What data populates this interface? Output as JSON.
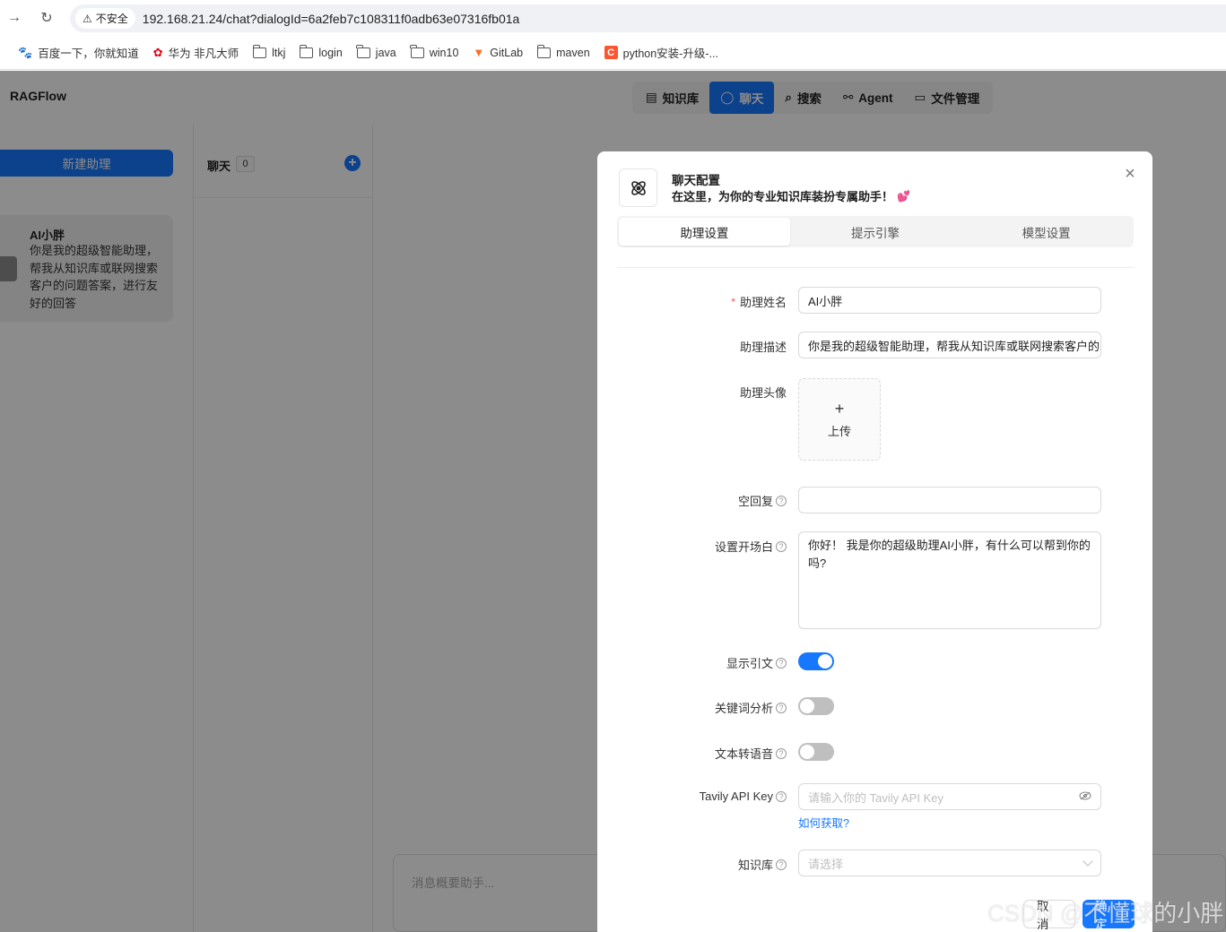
{
  "browser": {
    "insecure_label": "不安全",
    "url": "192.168.21.24/chat?dialogId=6a2feb7c108311f0adb63e07316fb01a",
    "bookmarks": [
      {
        "label": "百度一下，你就知道",
        "icon": "baidu-icon"
      },
      {
        "label": "华为 非凡大师",
        "icon": "huawei-icon"
      },
      {
        "label": "ltkj",
        "icon": "folder-icon"
      },
      {
        "label": "login",
        "icon": "folder-icon"
      },
      {
        "label": "java",
        "icon": "folder-icon"
      },
      {
        "label": "win10",
        "icon": "folder-icon"
      },
      {
        "label": "GitLab",
        "icon": "gitlab-icon"
      },
      {
        "label": "maven",
        "icon": "folder-icon"
      },
      {
        "label": "python安装-升级-...",
        "icon": "csdn-icon"
      }
    ]
  },
  "app": {
    "logo": "RAGFlow",
    "nav": [
      {
        "label": "知识库",
        "icon": "database-icon",
        "active": false
      },
      {
        "label": "聊天",
        "icon": "chat-icon",
        "active": true
      },
      {
        "label": "搜索",
        "icon": "search-icon",
        "active": false
      },
      {
        "label": "Agent",
        "icon": "agent-icon",
        "active": false
      },
      {
        "label": "文件管理",
        "icon": "folder-icon",
        "active": false
      }
    ],
    "left": {
      "new_button": "新建助理",
      "assistant": {
        "name": "AI小胖",
        "desc": "你是我的超级智能助理，帮我从知识库或联网搜索客户的问题答案，进行友好的回答"
      }
    },
    "middle": {
      "title": "聊天",
      "count": "0"
    },
    "message_placeholder": "消息概要助手..."
  },
  "modal": {
    "title": "聊天配置",
    "subtitle": "在这里，为你的专业知识库装扮专属助手！",
    "tabs": [
      {
        "label": "助理设置",
        "active": true
      },
      {
        "label": "提示引擎",
        "active": false
      },
      {
        "label": "模型设置",
        "active": false
      }
    ],
    "fields": {
      "name_label": "助理姓名",
      "name_value": "AI小胖",
      "desc_label": "助理描述",
      "desc_value": "你是我的超级智能助理，帮我从知识库或联网搜索客户的",
      "avatar_label": "助理头像",
      "upload_label": "上传",
      "empty_reply_label": "空回复",
      "empty_reply_value": "",
      "opener_label": "设置开场白",
      "opener_value": "你好！ 我是你的超级助理AI小胖，有什么可以帮到你的吗?",
      "show_quote_label": "显示引文",
      "show_quote_on": true,
      "keyword_label": "关键词分析",
      "keyword_on": false,
      "tts_label": "文本转语音",
      "tts_on": false,
      "tavily_label": "Tavily API Key",
      "tavily_placeholder": "请输入你的 Tavily API Key",
      "tavily_link": "如何获取?",
      "kb_label": "知识库",
      "kb_placeholder": "请选择"
    },
    "cancel": "取 消",
    "ok": "确 定"
  },
  "watermark": "CSDN @不懂球的小胖"
}
